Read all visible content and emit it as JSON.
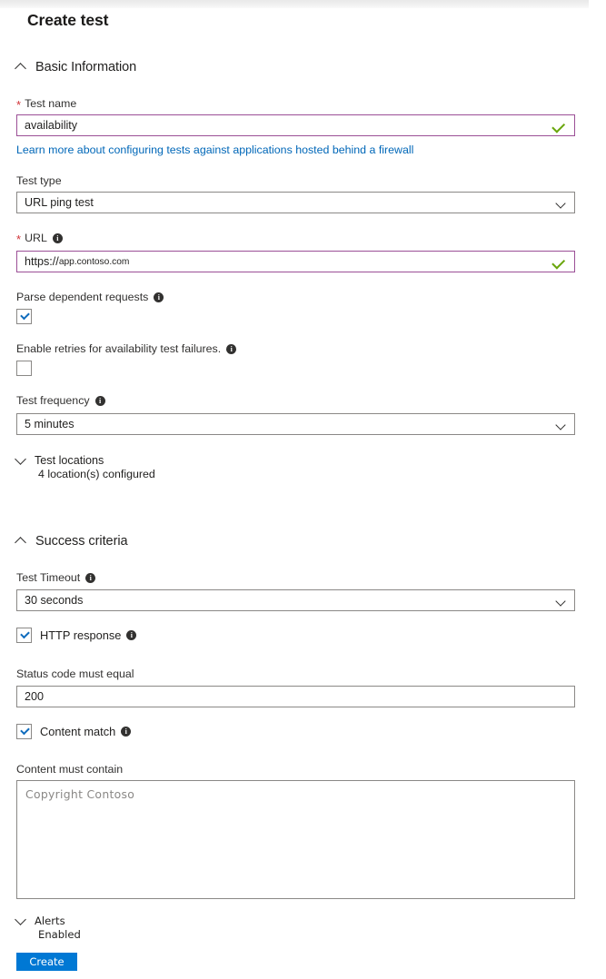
{
  "header": {
    "title": "Create test"
  },
  "sections": {
    "basic": {
      "label": "Basic Information",
      "chevron": "chevron-up-icon"
    },
    "success": {
      "label": "Success criteria",
      "chevron": "chevron-up-icon"
    }
  },
  "fields": {
    "test_name": {
      "label": "Test name",
      "required_marker": "*",
      "value": "availability",
      "placeholder": "",
      "validation": "valid-check-icon"
    },
    "learn_more_link": {
      "text": "Learn more about configuring tests against applications hosted behind a firewall"
    },
    "test_type": {
      "label": "Test type",
      "value": "URL ping test",
      "options": [
        "URL ping test"
      ]
    },
    "url": {
      "label": "URL",
      "required_marker": "*",
      "info": "info-icon",
      "value_scheme": "https://",
      "value_host": "app.contoso.com",
      "validation": "valid-check-icon"
    },
    "parse_dependent_requests": {
      "label": "Parse dependent requests",
      "info": "info-icon",
      "checked": true
    },
    "enable_retries": {
      "label": "Enable retries for availability test failures.",
      "info": "info-icon",
      "checked": false
    },
    "test_frequency": {
      "label": "Test frequency",
      "info": "info-icon",
      "value": "5 minutes",
      "options": [
        "5 minutes"
      ]
    },
    "test_locations": {
      "title": "Test locations",
      "subtitle": "4 location(s) configured",
      "chevron": "chevron-down-icon"
    },
    "test_timeout": {
      "label": "Test Timeout",
      "info": "info-icon",
      "value": "30 seconds",
      "options": [
        "30 seconds"
      ]
    },
    "http_response": {
      "label": "HTTP response",
      "info": "info-icon",
      "checked": true
    },
    "status_code": {
      "label": "Status code must equal",
      "value": "200"
    },
    "content_match": {
      "label": "Content match",
      "info": "info-icon",
      "checked": true
    },
    "content_must_contain": {
      "label": "Content must contain",
      "value": "",
      "placeholder": "Copyright  Contoso"
    },
    "alerts": {
      "title": "Alerts",
      "subtitle": "Enabled",
      "chevron": "chevron-down-icon"
    }
  },
  "actions": {
    "create_button": "Create"
  },
  "colors": {
    "accent_blue": "#0078d4",
    "link_blue": "#0067b8",
    "valid_purple": "#9b4f96",
    "valid_green": "#6aa60d",
    "required_red": "#d13438",
    "border_gray": "#8a8886"
  }
}
